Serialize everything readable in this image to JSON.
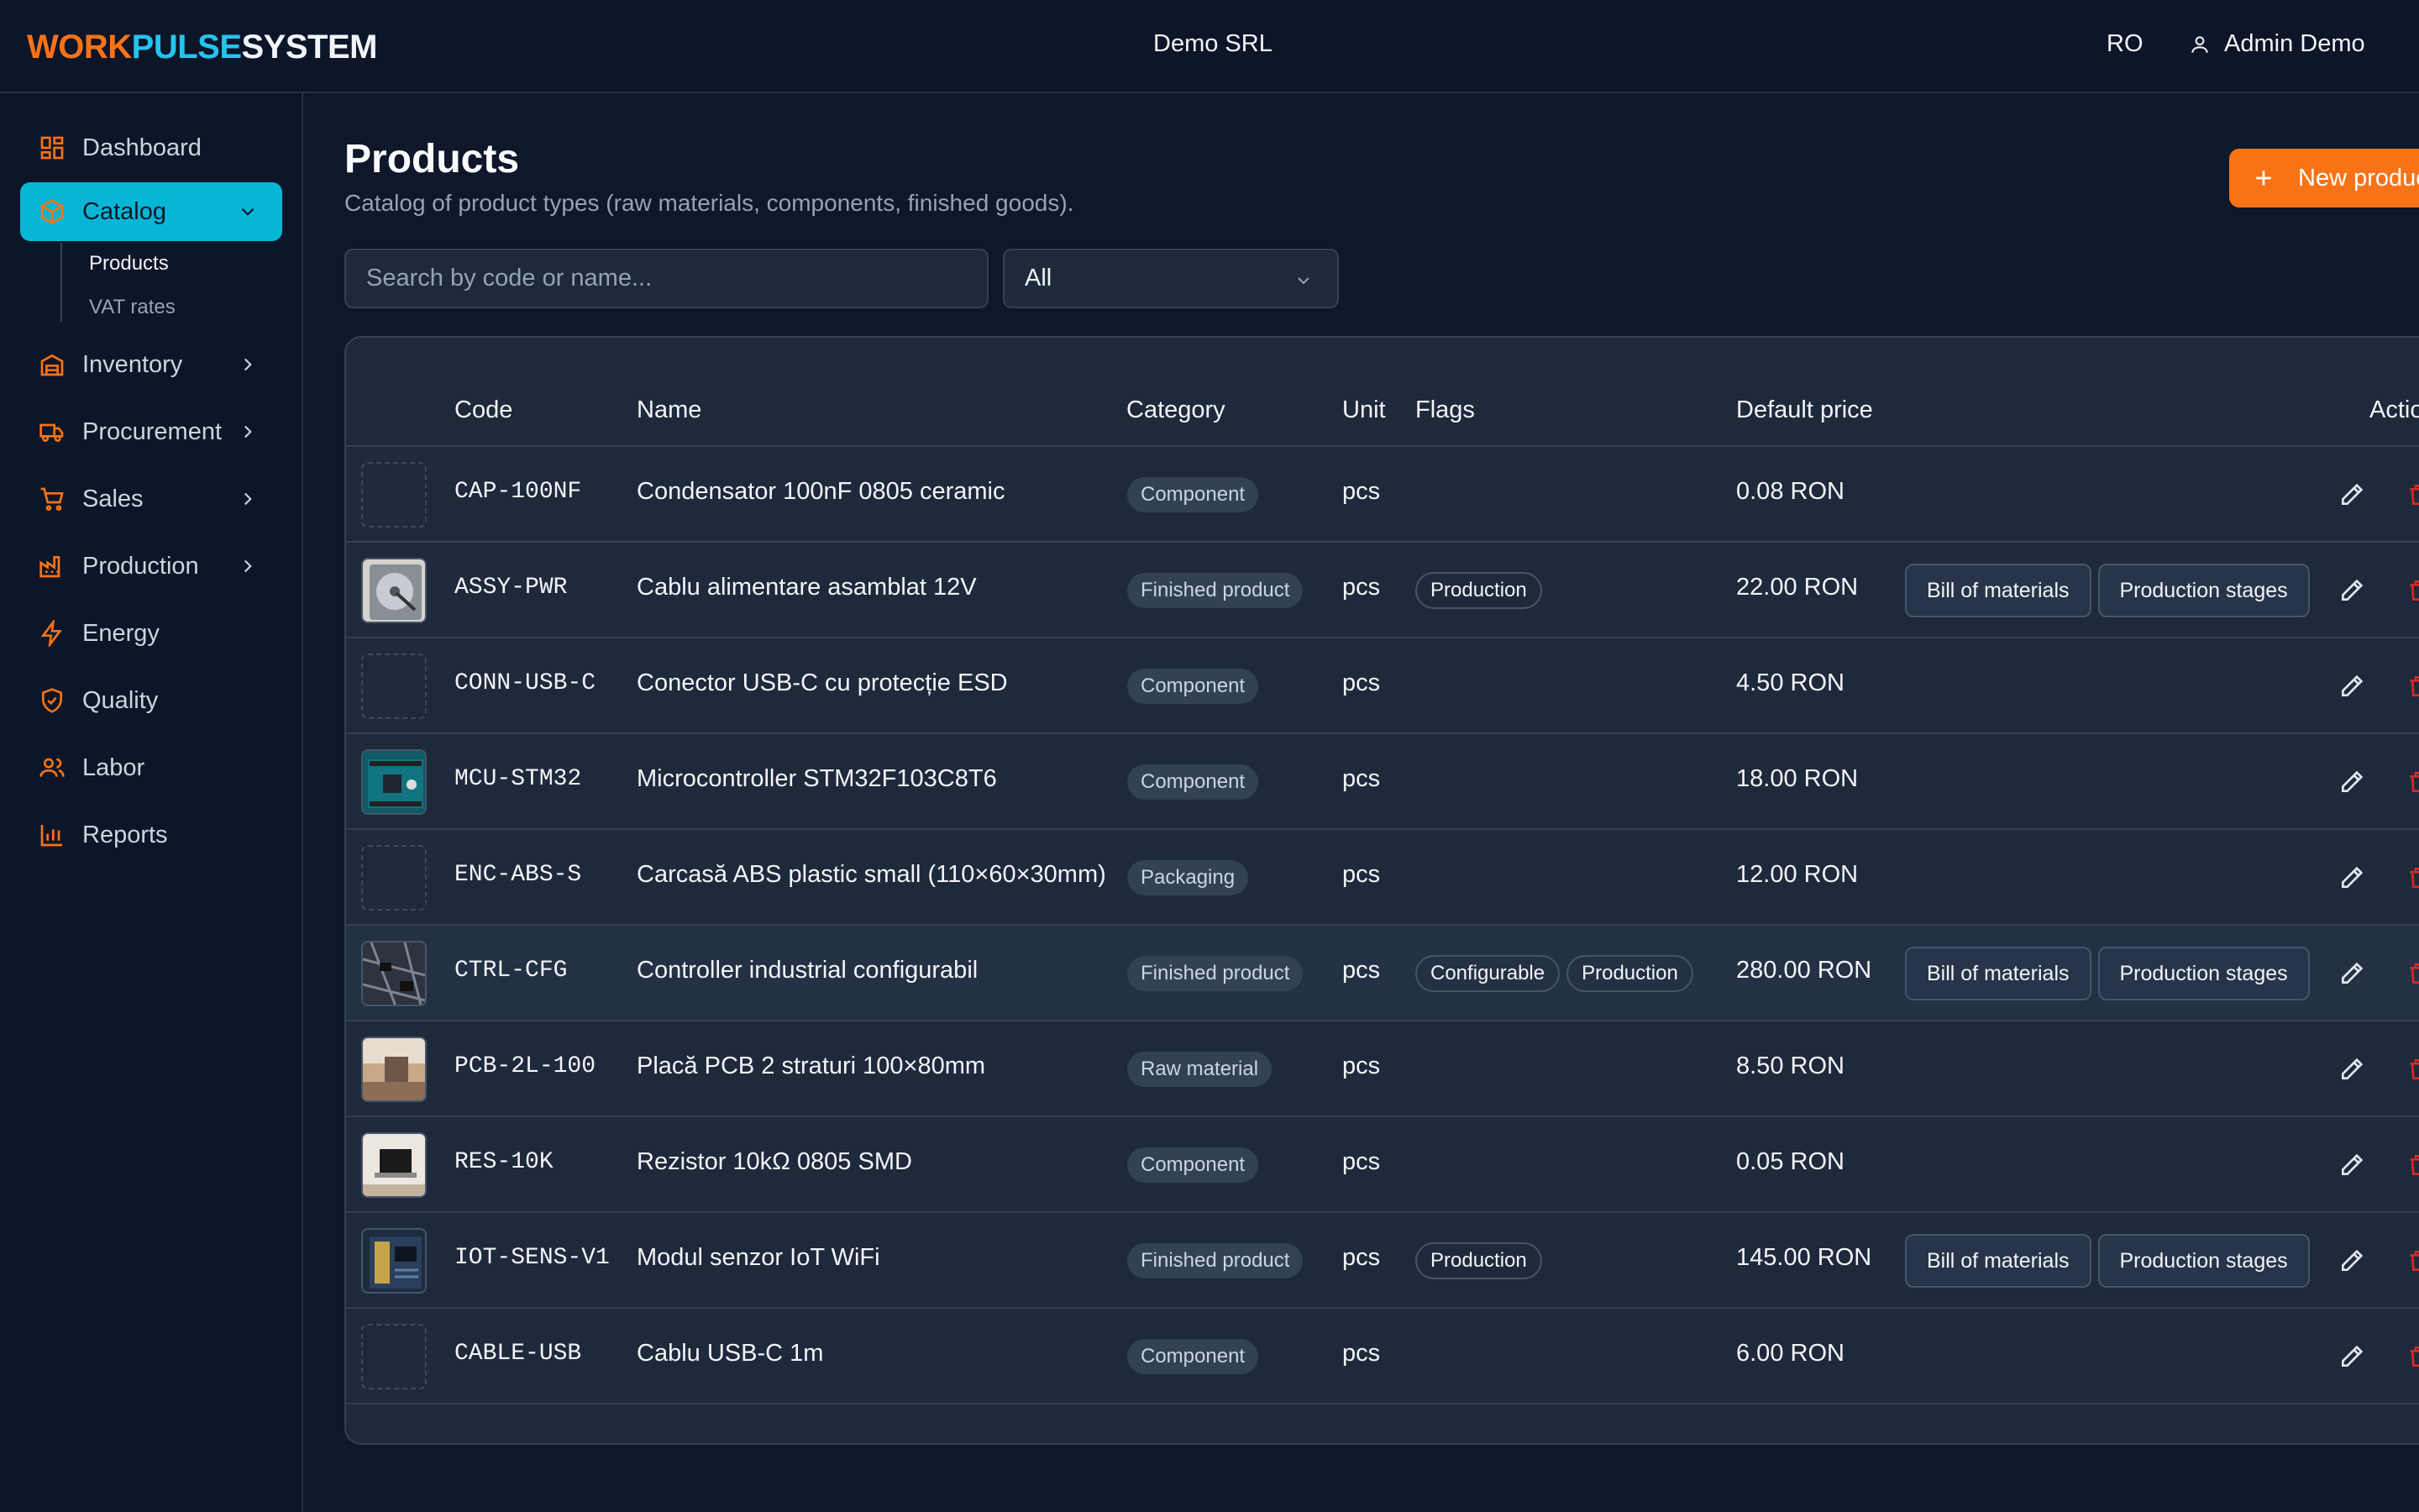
{
  "header": {
    "logo": {
      "part1": "WORK",
      "part2": "PULSE",
      "part3": "SYSTEM"
    },
    "company": "Demo SRL",
    "language": "RO",
    "user": "Admin Demo",
    "user_icon": "user-icon"
  },
  "sidebar": {
    "items": [
      {
        "label": "Dashboard",
        "icon": "dashboard-icon"
      },
      {
        "label": "Catalog",
        "icon": "catalog-icon",
        "expanded": true
      },
      {
        "label": "Inventory",
        "icon": "warehouse-icon"
      },
      {
        "label": "Procurement",
        "icon": "truck-icon"
      },
      {
        "label": "Sales",
        "icon": "cart-icon"
      },
      {
        "label": "Production",
        "icon": "factory-icon"
      },
      {
        "label": "Energy",
        "icon": "lightning-icon"
      },
      {
        "label": "Quality",
        "icon": "shield-check-icon"
      },
      {
        "label": "Labor",
        "icon": "users-icon"
      },
      {
        "label": "Reports",
        "icon": "bar-chart-icon"
      }
    ],
    "catalog_sub": [
      "Products",
      "VAT rates"
    ]
  },
  "page": {
    "title": "Products",
    "subtitle": "Catalog of product types (raw materials, components, finished goods).",
    "new_button": "New product",
    "search_placeholder": "Search by code or name...",
    "filter_value": "All"
  },
  "table": {
    "headers": {
      "code": "Code",
      "name": "Name",
      "category": "Category",
      "unit": "Unit",
      "flags": "Flags",
      "price": "Default price",
      "actions": "Actions"
    },
    "actions": {
      "bom": "Bill of materials",
      "stages": "Production stages"
    },
    "rows": [
      {
        "code": "CAP-100NF",
        "name": "Condensator 100nF 0805 ceramic",
        "category": "Component",
        "unit": "pcs",
        "flags": [],
        "price": "0.08 RON",
        "image": "none"
      },
      {
        "code": "ASSY-PWR",
        "name": "Cablu alimentare asamblat 12V",
        "category": "Finished product",
        "unit": "pcs",
        "flags": [
          "Production"
        ],
        "price": "22.00 RON",
        "image": "disk"
      },
      {
        "code": "CONN-USB-C",
        "name": "Conector USB-C cu protecție ESD",
        "category": "Component",
        "unit": "pcs",
        "flags": [],
        "price": "4.50 RON",
        "image": "none"
      },
      {
        "code": "MCU-STM32",
        "name": "Microcontroller STM32F103C8T6",
        "category": "Component",
        "unit": "pcs",
        "flags": [],
        "price": "18.00 RON",
        "image": "board"
      },
      {
        "code": "ENC-ABS-S",
        "name": "Carcasă ABS plastic small (110×60×30mm)",
        "category": "Packaging",
        "unit": "pcs",
        "flags": [],
        "price": "12.00 RON",
        "image": "none"
      },
      {
        "code": "CTRL-CFG",
        "name": "Controller industrial configurabil",
        "category": "Finished product",
        "unit": "pcs",
        "flags": [
          "Configurable",
          "Production"
        ],
        "price": "280.00 RON",
        "image": "circuit"
      },
      {
        "code": "PCB-2L-100",
        "name": "Placă PCB 2 straturi 100×80mm",
        "category": "Raw material",
        "unit": "pcs",
        "flags": [],
        "price": "8.50 RON",
        "image": "bench"
      },
      {
        "code": "RES-10K",
        "name": "Rezistor 10kΩ 0805 SMD",
        "category": "Component",
        "unit": "pcs",
        "flags": [],
        "price": "0.05 RON",
        "image": "laptop"
      },
      {
        "code": "IOT-SENS-V1",
        "name": "Modul senzor IoT WiFi",
        "category": "Finished product",
        "unit": "pcs",
        "flags": [
          "Production"
        ],
        "price": "145.00 RON",
        "image": "module"
      },
      {
        "code": "CABLE-USB",
        "name": "Cablu USB-C 1m",
        "category": "Component",
        "unit": "pcs",
        "flags": [],
        "price": "6.00 RON",
        "image": "none"
      }
    ]
  },
  "colors": {
    "accent": "#06b6d4",
    "primary": "#f97316",
    "danger": "#dc2626"
  }
}
